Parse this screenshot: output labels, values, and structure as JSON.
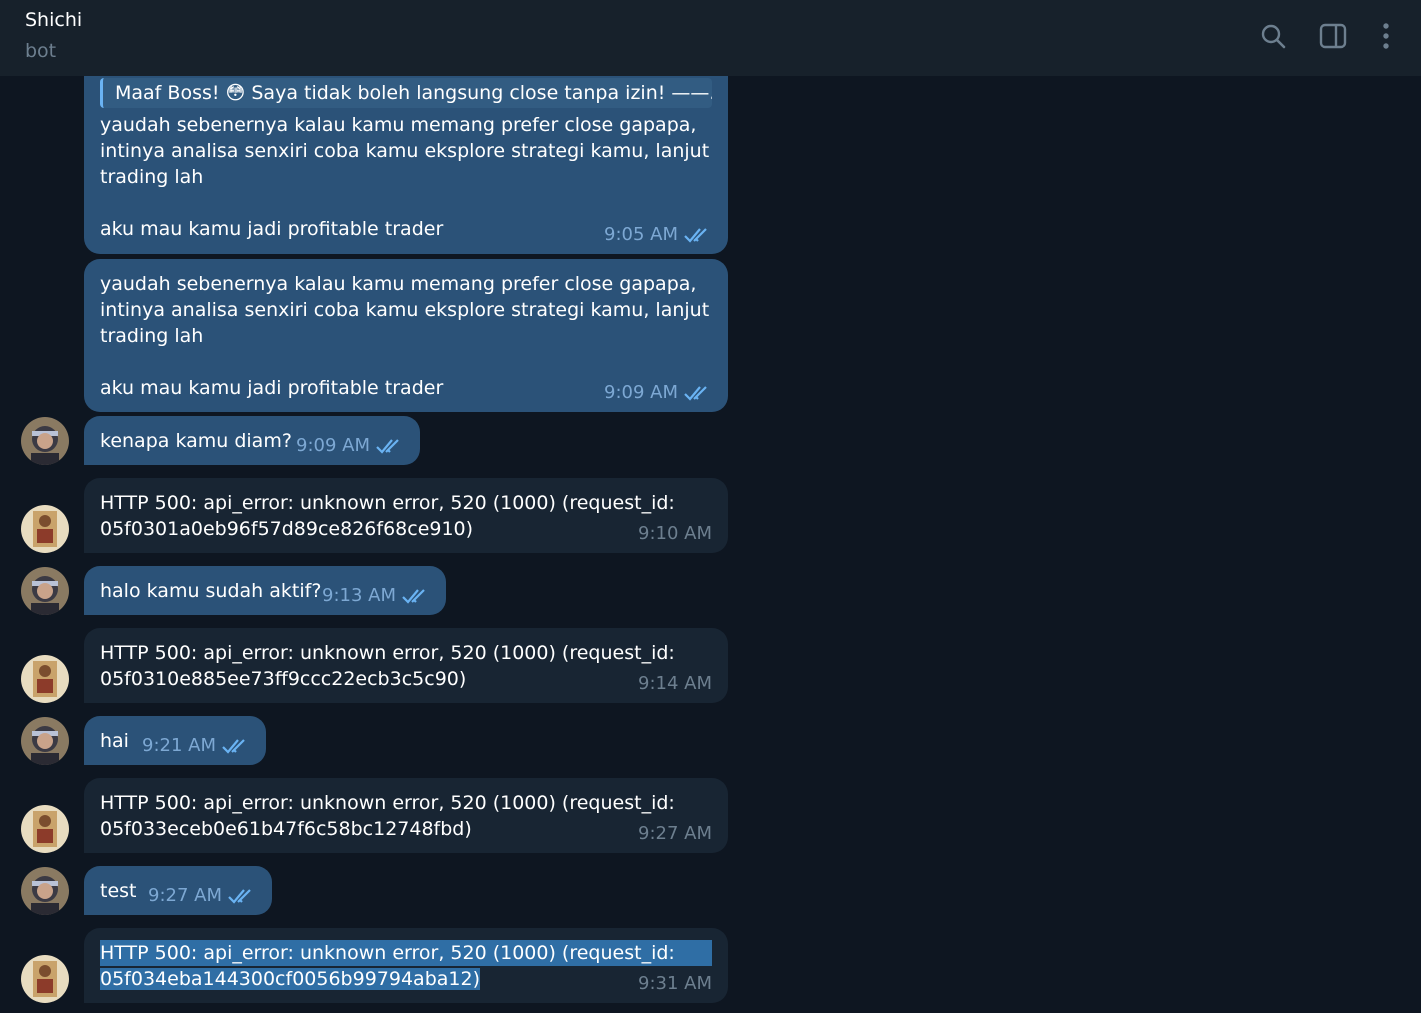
{
  "header": {
    "title": "Shichi",
    "status": "bot",
    "icons": [
      "search-icon",
      "sidebar-toggle-icon",
      "more-vertical-icon"
    ]
  },
  "colors": {
    "background": "#0e1621",
    "header": "#17212b",
    "outgoing_bubble": "#2b5278",
    "incoming_bubble": "#182533",
    "check": "#6ab3f3",
    "selection": "#2f6ea5"
  },
  "messages": [
    {
      "direction": "outgoing",
      "reply_quote": "Maaf Boss! 😳  Saya tidak boleh langsung close tanpa izin! ——...",
      "text": "yaudah sebenernya kalau kamu memang prefer close gapapa,\nintinya analisa senxiri coba kamu eksplore strategi kamu, lanjut\ntrading lah\n\naku mau kamu jadi profitable trader",
      "time": "9:05 AM"
    },
    {
      "direction": "outgoing",
      "text": "yaudah sebenernya kalau kamu memang prefer close gapapa,\nintinya analisa senxiri coba kamu eksplore strategi kamu, lanjut\ntrading lah\n\naku mau kamu jadi profitable trader",
      "time": "9:09 AM"
    },
    {
      "direction": "outgoing",
      "text": "kenapa kamu diam?",
      "time": "9:09 AM"
    },
    {
      "direction": "incoming",
      "text": "HTTP 500: api_error: unknown error, 520 (1000) (request_id:\n05f0301a0eb96f57d89ce826f68ce910)",
      "time": "9:10 AM"
    },
    {
      "direction": "outgoing",
      "text": "halo kamu sudah aktif?",
      "time": "9:13 AM"
    },
    {
      "direction": "incoming",
      "text": "HTTP 500: api_error: unknown error, 520 (1000) (request_id:\n05f0310e885ee73ff9ccc22ecb3c5c90)",
      "time": "9:14 AM"
    },
    {
      "direction": "outgoing",
      "text": "hai",
      "time": "9:21 AM"
    },
    {
      "direction": "incoming",
      "text": "HTTP 500: api_error: unknown error, 520 (1000) (request_id:\n05f033eceb0e61b47f6c58bc12748fbd)",
      "time": "9:27 AM"
    },
    {
      "direction": "outgoing",
      "text": "test",
      "time": "9:27 AM"
    },
    {
      "direction": "incoming",
      "text_line1": "HTTP 500: api_error: unknown error, 520 (1000) (request_id:",
      "text_line2": "05f034eba144300cf0056b99794aba12)",
      "time": "9:31 AM",
      "selected": true
    }
  ]
}
